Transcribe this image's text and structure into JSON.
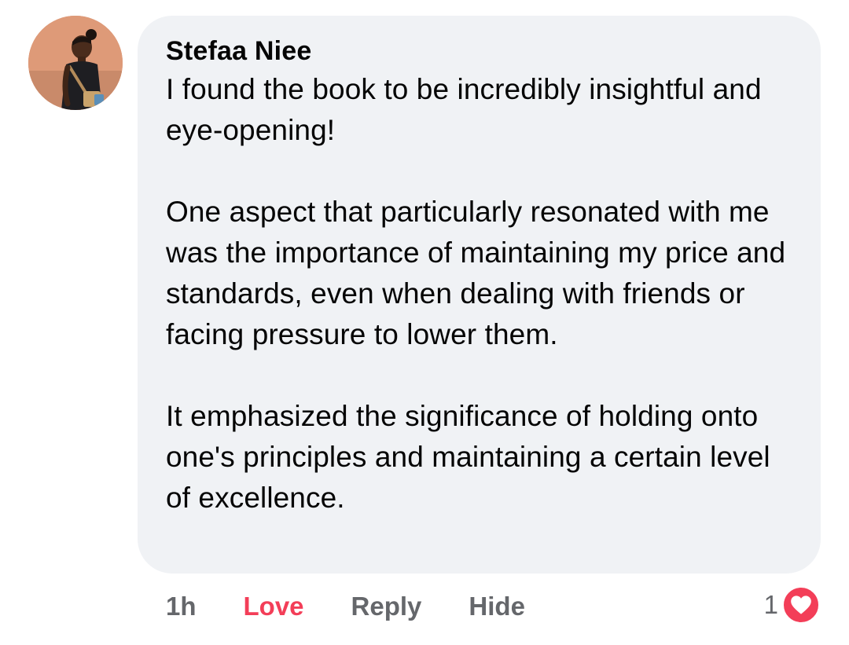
{
  "comment": {
    "author": "Stefaa Niee",
    "paragraphs": [
      "I found the book to be incredibly insightful and eye-opening!",
      "One aspect that particularly resonated with me was the importance of maintaining my price and standards, even when dealing with friends or facing pressure to lower them.",
      "It emphasized the significance of holding onto one's principles and maintaining a certain level of excellence."
    ],
    "time": "1h",
    "actions": {
      "love": "Love",
      "reply": "Reply",
      "hide": "Hide"
    },
    "reaction_count": "1",
    "reaction_icon": "heart-icon"
  },
  "colors": {
    "bubble": "#f0f2f5",
    "love": "#f33e58",
    "muted": "#65676b",
    "text": "#050505"
  }
}
